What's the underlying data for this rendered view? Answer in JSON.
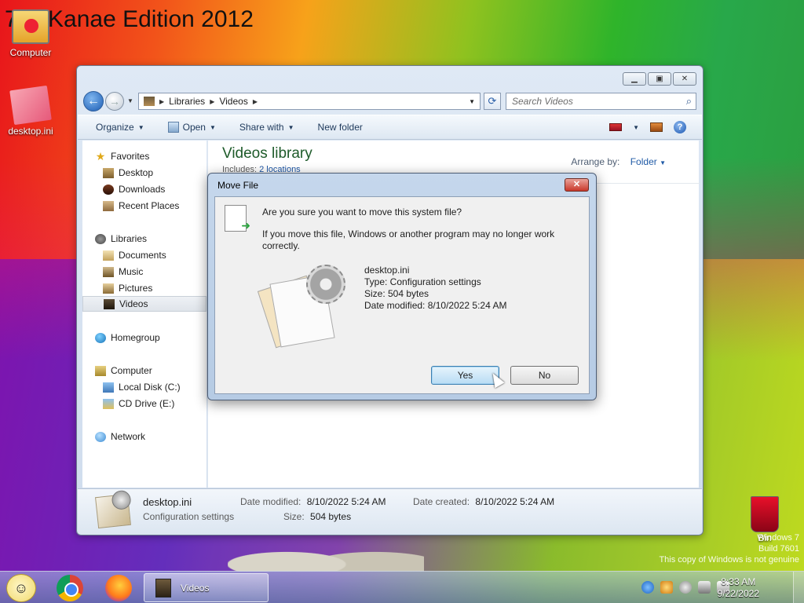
{
  "desktop": {
    "edition_title": "7 ssKanae Edition 2012",
    "icons": [
      {
        "label": "Computer",
        "icon": "computer-icon"
      },
      {
        "label": "desktop.ini",
        "icon": "ini-file-icon"
      },
      {
        "label": "Bin",
        "icon": "recycle-bin-icon"
      }
    ],
    "watermark": {
      "line1": "Windows 7",
      "line2": "Build 7601",
      "line3": "This copy of Windows is not genuine"
    }
  },
  "explorer": {
    "breadcrumb": [
      "Libraries",
      "Videos"
    ],
    "search_placeholder": "Search Videos",
    "toolbar": {
      "organize": "Organize",
      "open": "Open",
      "share_with": "Share with",
      "new_folder": "New folder"
    },
    "nav": {
      "favorites": "Favorites",
      "desktop": "Desktop",
      "downloads": "Downloads",
      "recent_places": "Recent Places",
      "libraries": "Libraries",
      "documents": "Documents",
      "music": "Music",
      "pictures": "Pictures",
      "videos": "Videos",
      "homegroup": "Homegroup",
      "computer": "Computer",
      "local_disk": "Local Disk (C:)",
      "cd_drive": "CD Drive (E:)",
      "network": "Network"
    },
    "main": {
      "library_title": "Videos library",
      "includes_label": "Includes:",
      "includes_link": "2 locations",
      "arrange_label": "Arrange by:",
      "arrange_value": "Folder"
    },
    "details": {
      "name": "desktop.ini",
      "type": "Configuration settings",
      "date_modified_label": "Date modified:",
      "date_modified": "8/10/2022 5:24 AM",
      "date_created_label": "Date created:",
      "date_created": "8/10/2022 5:24 AM",
      "size_label": "Size:",
      "size": "504 bytes"
    }
  },
  "dialog": {
    "title": "Move File",
    "question": "Are you sure you want to move this system file?",
    "message": "If you move this file, Windows or another program may no longer work correctly.",
    "file_name": "desktop.ini",
    "file_type": "Type: Configuration settings",
    "file_size": "Size: 504 bytes",
    "file_date": "Date modified: 8/10/2022 5:24 AM",
    "yes": "Yes",
    "no": "No"
  },
  "taskbar": {
    "task_label": "Videos",
    "time": "8:33 AM",
    "date": "9/22/2022"
  }
}
